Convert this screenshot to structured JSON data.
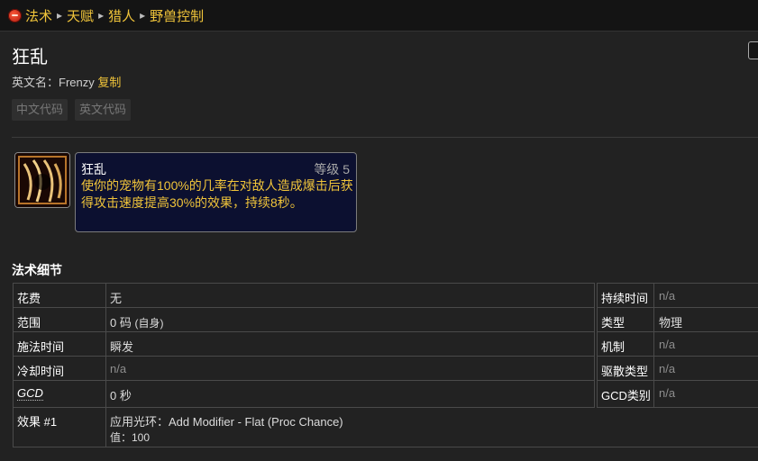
{
  "breadcrumb": {
    "items": [
      "法术",
      "天赋",
      "猎人",
      "野兽控制"
    ]
  },
  "spell": {
    "title": "狂乱",
    "english_label": "英文名：",
    "english_name": "Frenzy",
    "copy_label": "复制",
    "code_chips": [
      "中文代码",
      "英文代码"
    ],
    "icon": "frenzy-claw-icon"
  },
  "tooltip": {
    "name": "狂乱",
    "rank": "等级 5",
    "description": "使你的宠物有100%的几率在对敌人造成爆击后获得攻击速度提高30%的效果，持续8秒。"
  },
  "details": {
    "section_title": "法术细节",
    "left_rows": [
      {
        "key": "花费",
        "value": "无"
      },
      {
        "key": "范围",
        "value": "0 码",
        "extra": "(自身)"
      },
      {
        "key": "施法时间",
        "value": "瞬发"
      },
      {
        "key": "冷却时间",
        "value": "n/a"
      },
      {
        "key": "GCD",
        "value": "0 秒"
      }
    ],
    "right_rows": [
      {
        "key": "持续时间",
        "value": "n/a"
      },
      {
        "key": "类型",
        "value": "物理"
      },
      {
        "key": "机制",
        "value": "n/a"
      },
      {
        "key": "驱散类型",
        "value": "n/a"
      },
      {
        "key": "GCD类别",
        "value": "n/a"
      }
    ],
    "effect": {
      "key": "效果 #1",
      "line1": "应用光环：Add Modifier - Flat (Proc Chance)",
      "line2": "值：100"
    }
  },
  "colors": {
    "accent": "#f0c43a",
    "tooltip_bg": "#0c1030",
    "page_bg": "#1f1f1f"
  }
}
